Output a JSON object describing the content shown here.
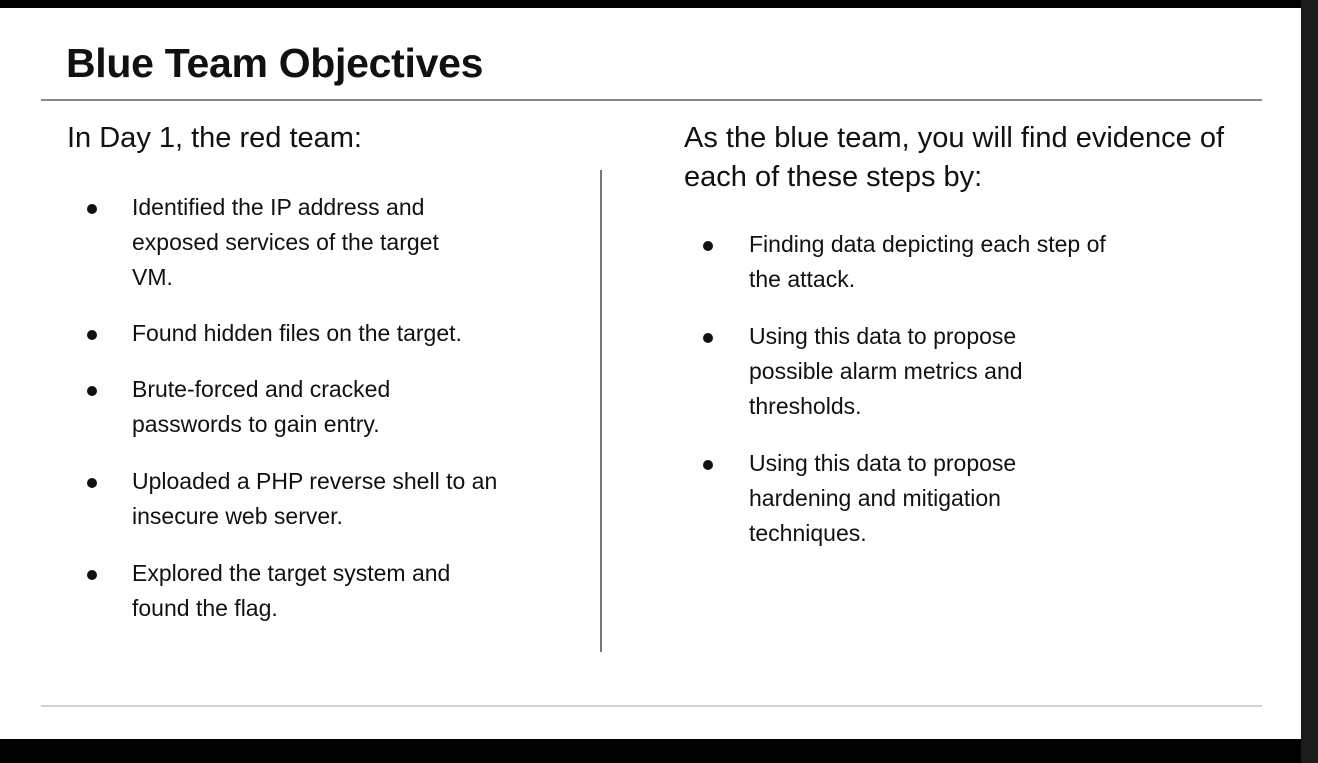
{
  "slide": {
    "title": "Blue Team Objectives",
    "left": {
      "heading": "In Day 1, the red team:",
      "items": [
        "Identified the IP address and exposed services of the target VM.",
        "Found hidden files on the target.",
        "Brute-forced and cracked passwords to gain entry.",
        "Uploaded a PHP reverse shell to an insecure web server.",
        "Explored the target system and found the flag."
      ]
    },
    "right": {
      "heading": "As the blue team, you will find evidence of each of these steps by:",
      "items": [
        "Finding data depicting each step of the attack.",
        "Using this data to propose possible alarm metrics and thresholds.",
        "Using this data to propose hardening and mitigation techniques."
      ]
    }
  }
}
